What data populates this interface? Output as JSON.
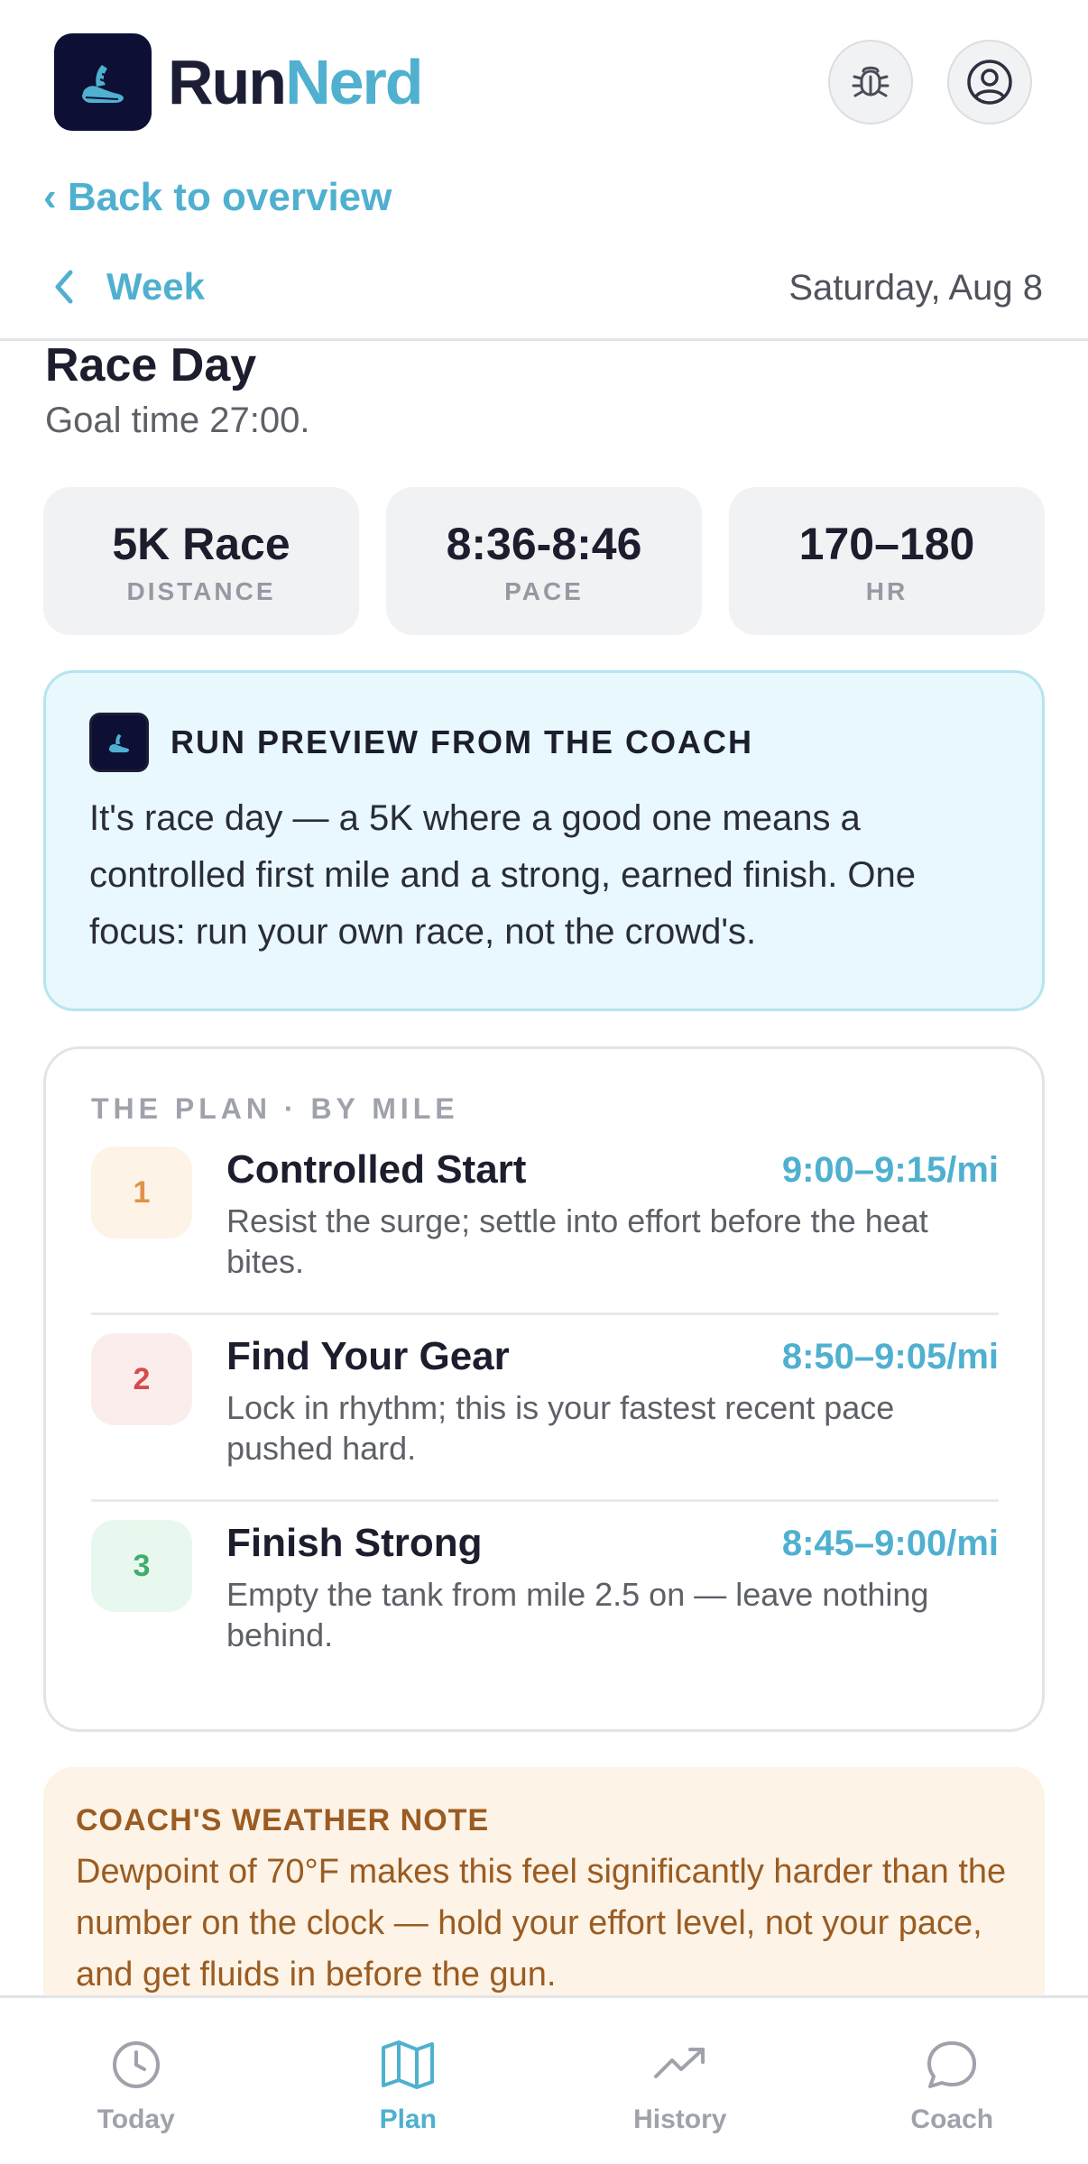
{
  "header": {
    "brand_part1": "Run",
    "brand_part2": "Nerd",
    "logo_icon": "running-shoe-icon",
    "bug_icon": "bug-icon",
    "account_icon": "user-circle-icon",
    "brand_dark": "#1c1e35",
    "brand_accent": "#4fb0d0"
  },
  "nav_back": {
    "back_link": "‹ Back to overview"
  },
  "week_bar": {
    "week_label": "Week",
    "date": "Saturday, Aug 8"
  },
  "workout": {
    "title": "Race Day",
    "subtitle": "Goal time 27:00."
  },
  "stats": [
    {
      "value": "5K Race",
      "label": "DISTANCE"
    },
    {
      "value": "8:36-8:46",
      "label": "PACE"
    },
    {
      "value": "170–180",
      "label": "HR"
    }
  ],
  "coach_preview": {
    "title": "RUN PREVIEW FROM THE COACH",
    "text": "It's race day — a 5K where a good one means a controlled first mile and a strong, earned finish. One focus: run your own race, not the crowd's."
  },
  "plan": {
    "title": "THE PLAN · BY MILE",
    "miles": [
      {
        "num": "1",
        "name": "Controlled Start",
        "pace": "9:00–9:15/mi",
        "desc": "Resist the surge; settle into effort before the heat bites.",
        "color": "#e09246"
      },
      {
        "num": "2",
        "name": "Find Your Gear",
        "pace": "8:50–9:05/mi",
        "desc": "Lock in rhythm; this is your fastest recent pace pushed hard.",
        "color": "#d44c4c"
      },
      {
        "num": "3",
        "name": "Finish Strong",
        "pace": "8:45–9:00/mi",
        "desc": "Empty the tank from mile 2.5 on — leave nothing behind.",
        "color": "#3fad6c"
      }
    ]
  },
  "weather": {
    "title": "COACH'S WEATHER NOTE",
    "text": "Dewpoint of 70°F makes this feel significantly harder than the number on the clock — hold your effort level, not your pace, and get fluids in before the gun."
  },
  "bottom_nav": {
    "items": [
      {
        "label": "Today",
        "icon": "clock-icon",
        "active": false
      },
      {
        "label": "Plan",
        "icon": "map-icon",
        "active": true
      },
      {
        "label": "History",
        "icon": "trending-up-icon",
        "active": false
      },
      {
        "label": "Coach",
        "icon": "chat-bubble-icon",
        "active": false
      }
    ]
  }
}
